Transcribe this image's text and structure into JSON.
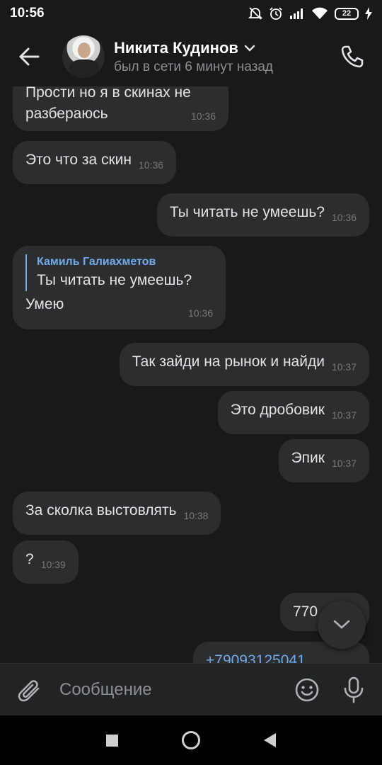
{
  "status_bar": {
    "time": "10:56",
    "battery": "22"
  },
  "header": {
    "contact_name": "Никита Кудинов",
    "contact_status": "был в сети 6 минут назад"
  },
  "messages": [
    {
      "side": "in",
      "text": "Прости но я в скинах не разбераюсь",
      "time": "10:36"
    },
    {
      "side": "in",
      "text": "Это что за скин",
      "time": "10:36"
    },
    {
      "side": "out",
      "text": "Ты читать не умеешь?",
      "time": "10:36"
    },
    {
      "side": "in",
      "reply_author": "Камиль Галиахметов",
      "reply_text": "Ты читать не умеешь?",
      "text": "Умею",
      "time": "10:36"
    },
    {
      "side": "out",
      "text": "Так зайди на рынок и найди",
      "time": "10:37"
    },
    {
      "side": "out",
      "text": "Это дробовик",
      "time": "10:37"
    },
    {
      "side": "out",
      "text": "Эпик",
      "time": "10:37"
    },
    {
      "side": "in",
      "text": "За сколка выстовлять",
      "time": "10:38"
    },
    {
      "side": "in",
      "text": "?",
      "time": "10:39"
    },
    {
      "side": "out",
      "text": "770",
      "time": ""
    },
    {
      "side": "out",
      "text": "+79093125041",
      "time": ""
    }
  ],
  "composer": {
    "placeholder": "Сообщение"
  },
  "colors": {
    "background": "#19191a",
    "bubble": "#2c2d2e",
    "accent": "#71aaeb",
    "secondary_text": "#8c8f94"
  },
  "icons": [
    "arrow-left-icon",
    "chevron-down-icon",
    "phone-icon",
    "paperclip-icon",
    "smile-icon",
    "microphone-icon",
    "chevron-down-icon"
  ]
}
